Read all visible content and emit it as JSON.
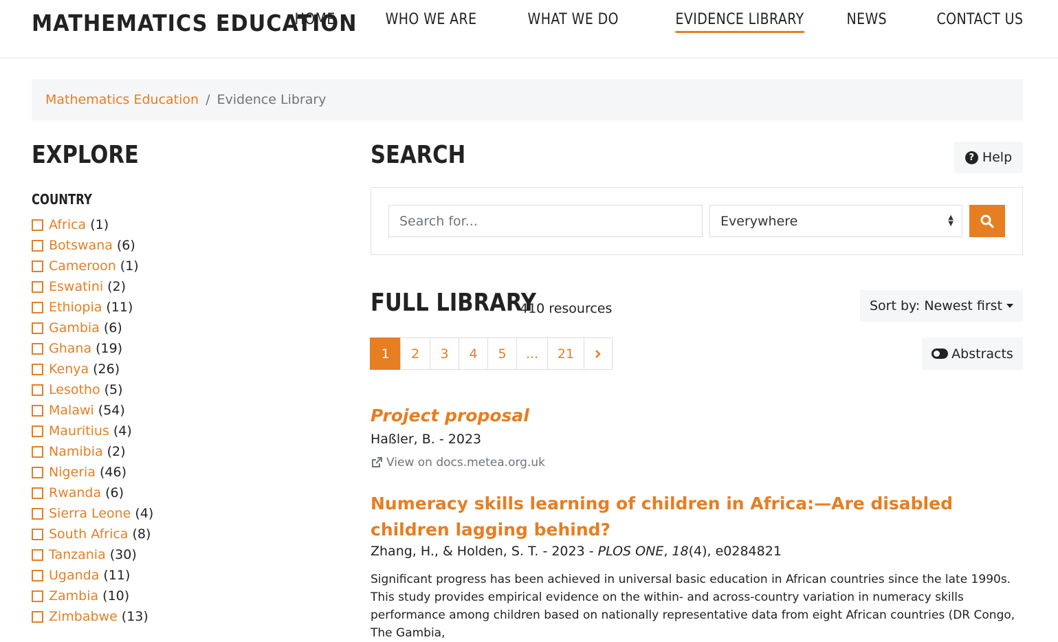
{
  "header": {
    "brand": "MATHEMATICS EDUCATION",
    "nav": [
      "HOME",
      "WHO WE ARE",
      "WHAT WE DO",
      "EVIDENCE LIBRARY",
      "NEWS",
      "CONTACT US"
    ],
    "active_nav": "EVIDENCE LIBRARY"
  },
  "breadcrumb": {
    "home": "Mathematics Education",
    "separator": "/",
    "current": "Evidence Library"
  },
  "explore": {
    "title": "EXPLORE",
    "country_heading": "COUNTRY",
    "countries": [
      {
        "name": "Africa",
        "count": "(1)"
      },
      {
        "name": "Botswana",
        "count": "(6)"
      },
      {
        "name": "Cameroon",
        "count": "(1)"
      },
      {
        "name": "Eswatini",
        "count": "(2)"
      },
      {
        "name": "Ethiopia",
        "count": "(11)"
      },
      {
        "name": "Gambia",
        "count": "(6)"
      },
      {
        "name": "Ghana",
        "count": "(19)"
      },
      {
        "name": "Kenya",
        "count": "(26)"
      },
      {
        "name": "Lesotho",
        "count": "(5)"
      },
      {
        "name": "Malawi",
        "count": "(54)"
      },
      {
        "name": "Mauritius",
        "count": "(4)"
      },
      {
        "name": "Namibia",
        "count": "(2)"
      },
      {
        "name": "Nigeria",
        "count": "(46)"
      },
      {
        "name": "Rwanda",
        "count": "(6)"
      },
      {
        "name": "Sierra Leone",
        "count": "(4)"
      },
      {
        "name": "South Africa",
        "count": "(8)"
      },
      {
        "name": "Tanzania",
        "count": "(30)"
      },
      {
        "name": "Uganda",
        "count": "(11)"
      },
      {
        "name": "Zambia",
        "count": "(10)"
      },
      {
        "name": "Zimbabwe",
        "count": "(13)"
      }
    ]
  },
  "search": {
    "title": "SEARCH",
    "help_label": "Help",
    "placeholder": "Search for...",
    "scope_value": "Everywhere"
  },
  "library": {
    "title": "FULL LIBRARY",
    "count": "410 resources",
    "sort_label": "Sort by: Newest first",
    "abstracts_label": "Abstracts",
    "pages": [
      "1",
      "2",
      "3",
      "4",
      "5",
      "...",
      "21"
    ],
    "current_page": "1"
  },
  "results": [
    {
      "title": "Project proposal",
      "meta": "Haßler, B. - 2023",
      "link": "View on docs.metea.org.uk"
    },
    {
      "title": "Numeracy skills learning of children in Africa:—Are disabled children lagging behind?",
      "authors": "Zhang, H., & Holden, S. T. - 2023 - ",
      "journal": "PLOS ONE",
      "sep": ", ",
      "volume": "18",
      "rest": "(4), e0284821",
      "abstract": "Significant progress has been achieved in universal basic education in African countries since the late 1990s. This study provides empirical evidence on the within- and across-country variation in numeracy skills performance among children based on nationally representative data from eight African countries (DR Congo, The Gambia,"
    }
  ],
  "colors": {
    "accent": "#e67e22",
    "panel": "#f5f6f7",
    "text": "#222222",
    "muted": "#6c757d"
  }
}
